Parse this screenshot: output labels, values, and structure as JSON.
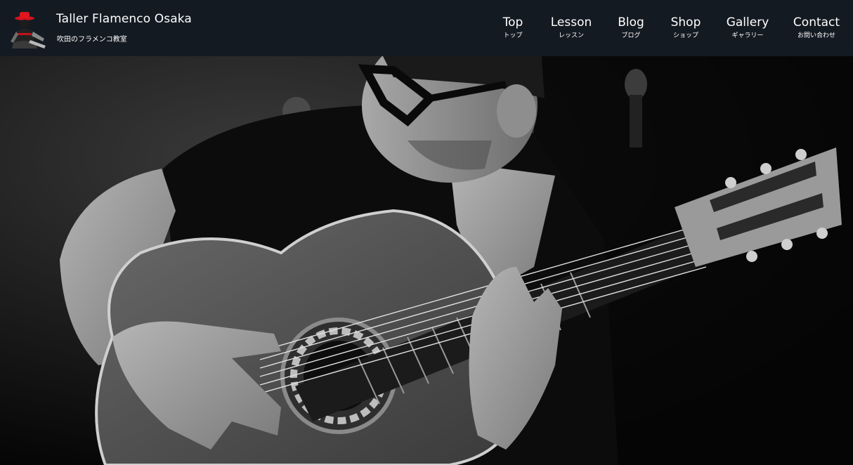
{
  "header": {
    "site_title": "Taller Flamenco Osaka",
    "site_tagline": "吹田のフラメンコ教室",
    "background_color": "#141a22",
    "logo_icon": "flamenco-dancer-logo-icon"
  },
  "nav": {
    "items": [
      {
        "label": "Top",
        "sublabel": "トップ"
      },
      {
        "label": "Lesson",
        "sublabel": "レッスン"
      },
      {
        "label": "Blog",
        "sublabel": "ブログ"
      },
      {
        "label": "Shop",
        "sublabel": "ショップ"
      },
      {
        "label": "Gallery",
        "sublabel": "ギャラリー"
      },
      {
        "label": "Contact",
        "sublabel": "お問い合わせ"
      }
    ]
  },
  "hero": {
    "image_subject": "guitarist-playing-acoustic-guitar-bw-photo"
  }
}
